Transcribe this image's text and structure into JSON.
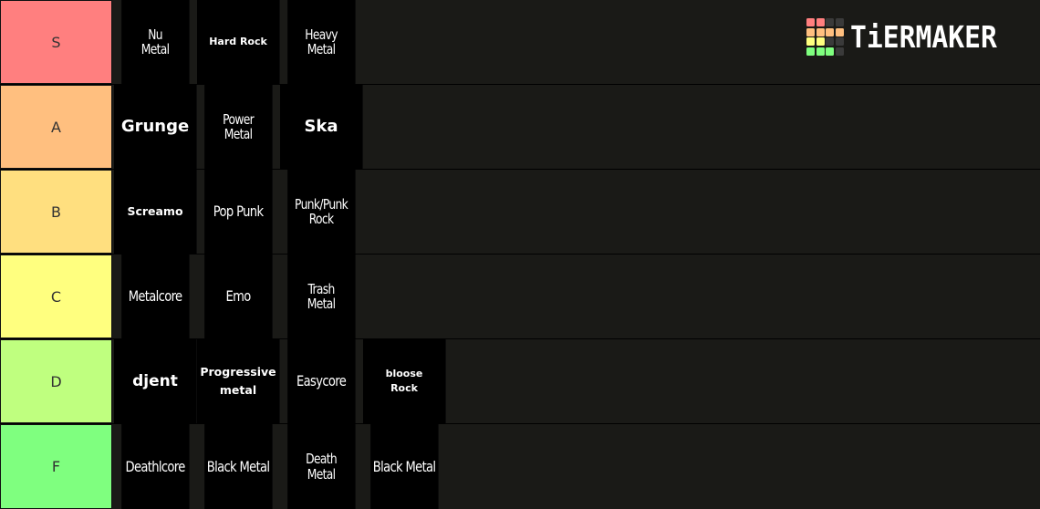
{
  "app": "TierMaker",
  "logo": {
    "text": "TiERMAKER",
    "grid_colors": [
      "#ff7f7f",
      "#ff7f7f",
      "#3a3a3a",
      "#3a3a3a",
      "#ffbf7f",
      "#ffbf7f",
      "#ffbf7f",
      "#ffbf7f",
      "#ffff7f",
      "#ffff7f",
      "#3a3a3a",
      "#3a3a3a",
      "#7fff7f",
      "#7fff7f",
      "#7fff7f",
      "#3a3a3a"
    ]
  },
  "tiers": [
    {
      "label": "S",
      "color": "#ff7f7f",
      "items": [
        "Nu Metal",
        "Hard Rock",
        "Heavy Metal"
      ]
    },
    {
      "label": "A",
      "color": "#ffbf7f",
      "items": [
        "Grunge",
        "Power Metal",
        "Ska"
      ]
    },
    {
      "label": "B",
      "color": "#ffdf7f",
      "items": [
        "Screamo",
        "Pop Punk",
        "Punk/Punk Rock"
      ]
    },
    {
      "label": "C",
      "color": "#ffff7f",
      "items": [
        "Metalcore",
        "Emo",
        "Trash Metal"
      ]
    },
    {
      "label": "D",
      "color": "#bfff7f",
      "items": [
        "djent",
        "Progressive metal",
        "Easycore",
        "bloose Rock"
      ]
    },
    {
      "label": "F",
      "color": "#7fff7f",
      "items": [
        "Deathlcore",
        "Black Metal",
        "Death Metal",
        "Black Metal"
      ]
    }
  ]
}
